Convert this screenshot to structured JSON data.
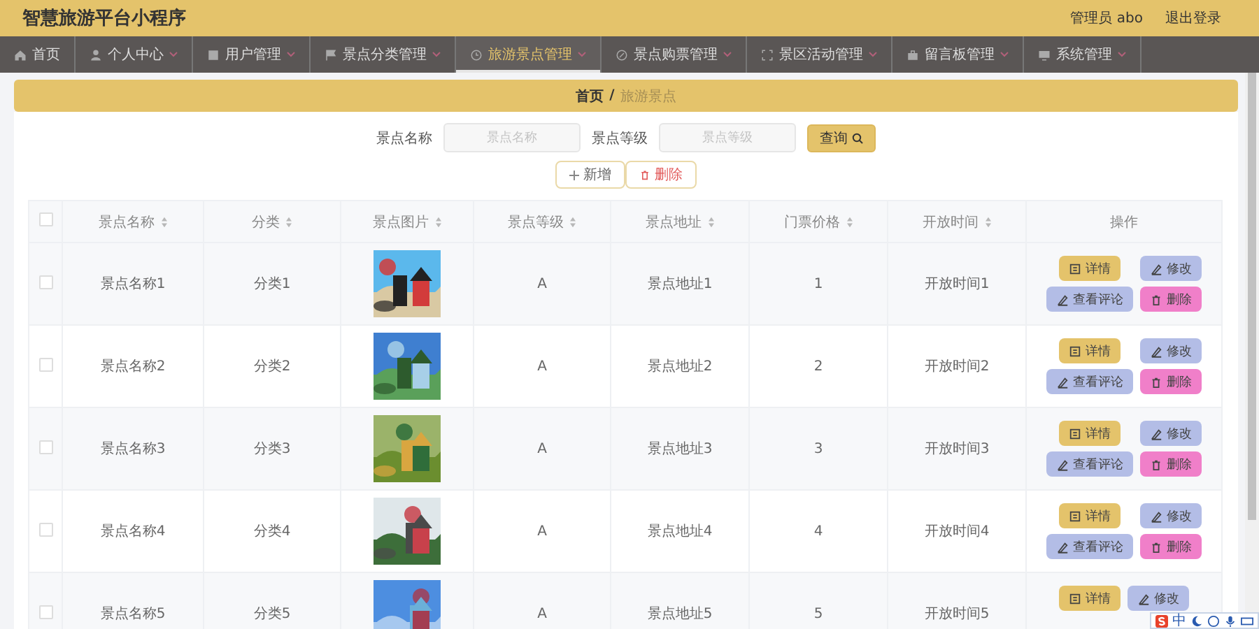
{
  "header": {
    "title": "智慧旅游平台小程序",
    "user": "管理员 abo",
    "logout": "退出登录"
  },
  "nav": [
    {
      "label": "首页",
      "dropdown": false,
      "selected": false
    },
    {
      "label": "个人中心",
      "dropdown": true,
      "selected": false
    },
    {
      "label": "用户管理",
      "dropdown": true,
      "selected": false
    },
    {
      "label": "景点分类管理",
      "dropdown": true,
      "selected": false
    },
    {
      "label": "旅游景点管理",
      "dropdown": true,
      "selected": true
    },
    {
      "label": "景点购票管理",
      "dropdown": true,
      "selected": false
    },
    {
      "label": "景区活动管理",
      "dropdown": true,
      "selected": false
    },
    {
      "label": "留言板管理",
      "dropdown": true,
      "selected": false
    },
    {
      "label": "系统管理",
      "dropdown": true,
      "selected": false
    }
  ],
  "breadcrumb": {
    "home": "首页",
    "separator": "/",
    "current": "旅游景点"
  },
  "search": {
    "fields": [
      {
        "label": "景点名称",
        "placeholder": "景点名称"
      },
      {
        "label": "景点等级",
        "placeholder": "景点等级"
      }
    ],
    "button": "查询"
  },
  "toolbar": {
    "add": "新增",
    "delete": "删除"
  },
  "table": {
    "select_all_checked": false,
    "columns": [
      "景点名称",
      "分类",
      "景点图片",
      "景点等级",
      "景点地址",
      "门票价格",
      "开放时间",
      "操作"
    ],
    "rows": [
      {
        "checked": false,
        "cells": [
          "景点名称1",
          "分类1",
          {
            "kind": "picture"
          },
          "A",
          "景点地址1",
          "1",
          "开放时间1"
        ],
        "actions": [
          {
            "kind": "detail",
            "label": "详情"
          },
          {
            "kind": "edit",
            "label": "修改"
          },
          {
            "kind": "review",
            "label": "查看评论"
          },
          {
            "kind": "delete",
            "label": "删除"
          }
        ]
      },
      {
        "checked": false,
        "cells": [
          "景点名称2",
          "分类2",
          {
            "kind": "picture"
          },
          "A",
          "景点地址2",
          "2",
          "开放时间2"
        ],
        "actions": [
          {
            "kind": "detail",
            "label": "详情"
          },
          {
            "kind": "edit",
            "label": "修改"
          },
          {
            "kind": "review",
            "label": "查看评论"
          },
          {
            "kind": "delete",
            "label": "删除"
          }
        ]
      },
      {
        "checked": false,
        "cells": [
          "景点名称3",
          "分类3",
          {
            "kind": "picture"
          },
          "A",
          "景点地址3",
          "3",
          "开放时间3"
        ],
        "actions": [
          {
            "kind": "detail",
            "label": "详情"
          },
          {
            "kind": "edit",
            "label": "修改"
          },
          {
            "kind": "review",
            "label": "查看评论"
          },
          {
            "kind": "delete",
            "label": "删除"
          }
        ]
      },
      {
        "checked": false,
        "cells": [
          "景点名称4",
          "分类4",
          {
            "kind": "picture"
          },
          "A",
          "景点地址4",
          "4",
          "开放时间4"
        ],
        "actions": [
          {
            "kind": "detail",
            "label": "详情"
          },
          {
            "kind": "edit",
            "label": "修改"
          },
          {
            "kind": "review",
            "label": "查看评论"
          },
          {
            "kind": "delete",
            "label": "删除"
          }
        ]
      },
      {
        "checked": false,
        "cells": [
          "景点名称5",
          "分类5",
          {
            "kind": "picture"
          },
          "A",
          "景点地址5",
          "5",
          "开放时间5"
        ],
        "actions": [
          {
            "kind": "detail",
            "label": "详情"
          },
          {
            "kind": "edit",
            "label": "修改"
          }
        ]
      }
    ]
  },
  "ime_toolbar": {
    "mode": "中"
  }
}
